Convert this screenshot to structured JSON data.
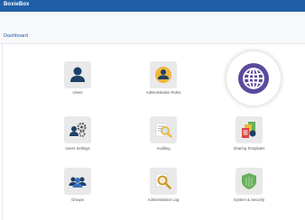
{
  "app": {
    "title": "BoxieBox"
  },
  "breadcrumb": {
    "current": "Dashboard"
  },
  "tiles": [
    {
      "label": "Users",
      "icon": "user-icon"
    },
    {
      "label": "Administration Roles",
      "icon": "admin-role-icon"
    },
    {
      "label": "",
      "icon": "globe-icon"
    },
    {
      "label": "Users Settings",
      "icon": "users-settings-icon"
    },
    {
      "label": "Auditing",
      "icon": "audit-icon"
    },
    {
      "label": "Sharing Templates",
      "icon": "sharing-templates-icon"
    },
    {
      "label": "Groups",
      "icon": "groups-icon"
    },
    {
      "label": "Administration Log",
      "icon": "admin-log-icon"
    },
    {
      "label": "System & Security",
      "icon": "shield-icon"
    }
  ],
  "colors": {
    "header": "#1f5fa8",
    "navy": "#1e3f67",
    "gold": "#f0b73a",
    "green": "#66b15a",
    "purple": "#5b4a9c"
  }
}
